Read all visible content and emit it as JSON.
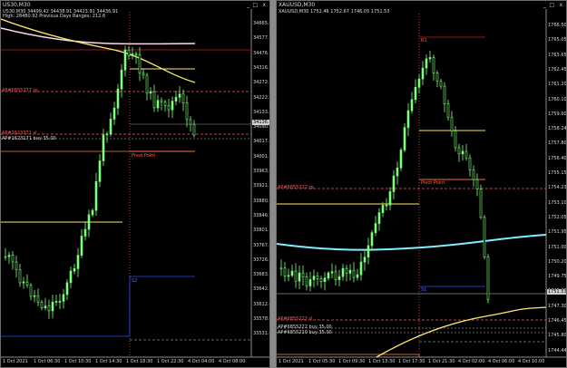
{
  "left": {
    "title": "US30,M30",
    "info1": "US30,M30  34499.42 34438.91 34423.91 34436.91",
    "info2": "High: 28480.92    Previous Days Ranges: 212.6",
    "price_labels": [
      "34665.00",
      "34577.29",
      "34476.35",
      "34316.75",
      "34272.70",
      "34222.60",
      "34133.49",
      "34090.65",
      "34017.45",
      "34001.20",
      "33963.00",
      "33921.15",
      "33880.60",
      "33846.95",
      "33801.30",
      "33767.60",
      "33726.25",
      "33683.30",
      "33642.50",
      "33612.40",
      "33578.05",
      "33531.00"
    ],
    "current_price": "34136.91",
    "time_labels": [
      "1 Oct 2021",
      "1 Oct 06:30",
      "1 Oct 10:30",
      "1 Oct 14:30",
      "1 Oct 18:30",
      "1 Oct 22:30",
      "4 Oct 04:00",
      "4 Oct 08:00"
    ],
    "horiz_labels": [
      {
        "text": "AP#6855277 tp",
        "color": "#ff5a5a"
      },
      {
        "text": "AP#1623371 sl",
        "color": "#ff5a5a"
      },
      {
        "text": "AP#1623171 buy 35.00",
        "color": "#dddddd"
      },
      {
        "text": "Pivot Point",
        "color": "#ff6a40"
      },
      {
        "text": "S1",
        "color": "#ff6a40"
      },
      {
        "text": "S2",
        "color": "#4f6bff"
      }
    ],
    "window_controls": [
      "_",
      "□",
      "x"
    ]
  },
  "right": {
    "title": "XAUUSD,M30",
    "info1": "XAUUSD,M30  1752.46 1752.67 1746.05 1751.53",
    "price_labels": [
      "1766.50",
      "1765.05",
      "1763.65",
      "1762.45",
      "1761.20",
      "1760.10",
      "1759.60",
      "1758.24",
      "1757.80",
      "1756.40",
      "1755.15",
      "1754.23",
      "1753.10",
      "1752.05",
      "1751.95",
      "1751.00",
      "1750.20",
      "1749.75",
      "1748.65",
      "1747.30",
      "1746.45",
      "1745.80",
      "1744.44"
    ],
    "current_price": "1751.53",
    "time_labels": [
      "1 Oct 2021",
      "1 Oct 05:30",
      "1 Oct 09:30",
      "1 Oct 13:30",
      "1 Oct 17:30",
      "1 Oct 21:30",
      "4 Oct 02:00",
      "4 Oct 06:00",
      "4 Oct 10:00"
    ],
    "horiz_labels": [
      {
        "text": "R1",
        "color": "#ff6a40"
      },
      {
        "text": "Pivot Point",
        "color": "#ff6a40"
      },
      {
        "text": "AP#6855222 tp",
        "color": "#ff5a5a"
      },
      {
        "text": "S1",
        "color": "#4f6bff"
      },
      {
        "text": "AP#6855222 sl",
        "color": "#ff5a5a"
      },
      {
        "text": "AP#6855222 buy 35.00",
        "color": "#dddddd"
      },
      {
        "text": "AP#6855210 buy 35.00",
        "color": "#dddddd"
      }
    ],
    "window_controls": [
      "_",
      "□",
      "x"
    ]
  },
  "colors": {
    "candle": "#7cff7c",
    "ma_pink": "#ffd8ea",
    "ma_yellow": "#ffe86a",
    "ma_cyan": "#7ff0ff",
    "pivot": "#ff6a40",
    "grid": "#6a6a6a"
  }
}
